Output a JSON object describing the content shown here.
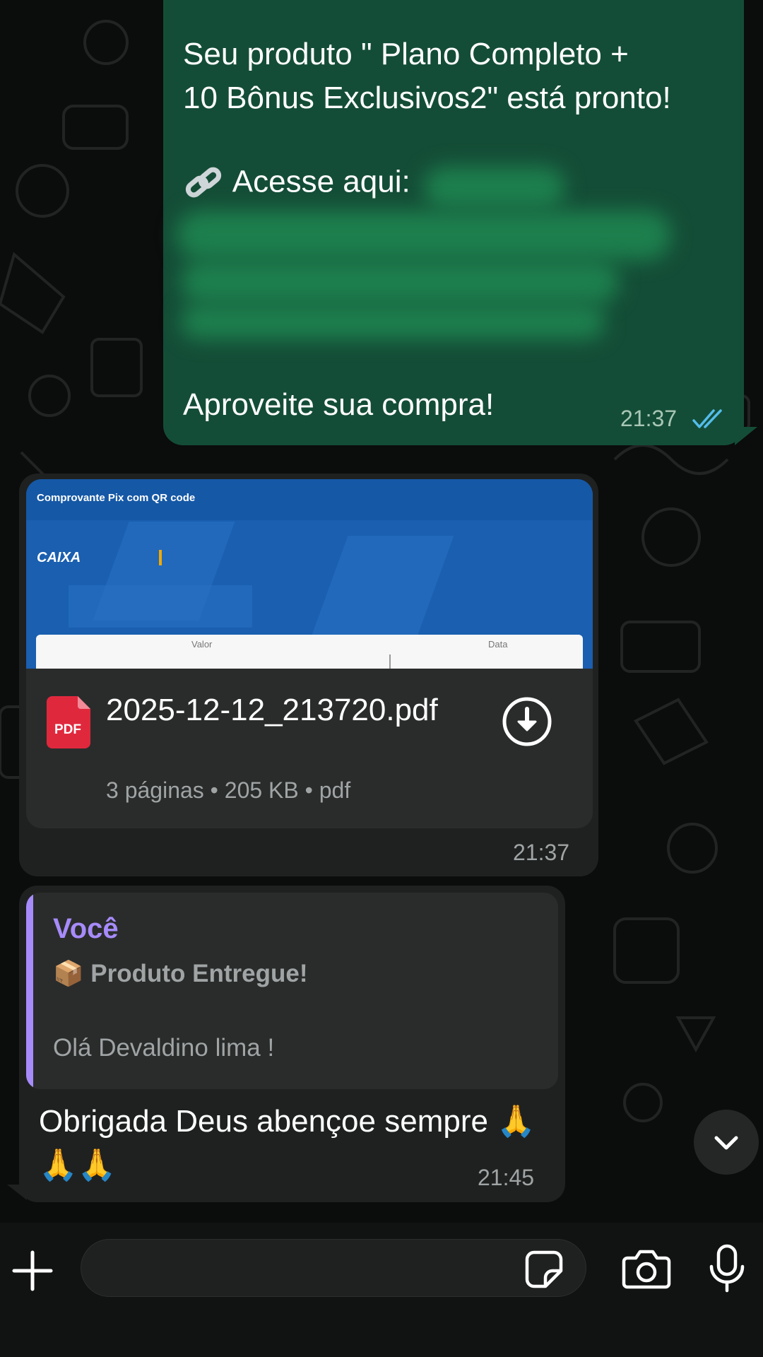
{
  "chat": {
    "outgoing": {
      "line1": "Seu produto \" Plano Completo +",
      "line2": "10 Bônus Exclusivos2\" está pronto!",
      "link_prefix": "Acesse aqui:",
      "footer": "Aproveite sua compra!",
      "time": "21:37",
      "read_status": "read",
      "link_icon": "link-icon"
    },
    "document": {
      "preview_title": "Comprovante Pix com QR code",
      "preview_logo": "CAIXA",
      "preview_label_left": "Valor",
      "preview_label_right": "Data",
      "file_name": "2025-12-12_213720.pdf",
      "file_icon_label": "PDF",
      "meta": "3 páginas • 205 KB • pdf",
      "time": "21:37"
    },
    "reply": {
      "quoted_author": "Você",
      "quoted_title": "📦 Produto Entregue!",
      "quoted_body": "Olá Devaldino lima !",
      "text": "Obrigada Deus abençoe sempre 🙏🙏🙏",
      "time": "21:45"
    }
  },
  "composer": {
    "input_value": "",
    "input_placeholder": ""
  },
  "colors": {
    "outgoing_bubble": "#144d37",
    "incoming_bubble": "#1f2121",
    "quote_accent": "#a78bfa",
    "read_ticks": "#53bdeb"
  }
}
